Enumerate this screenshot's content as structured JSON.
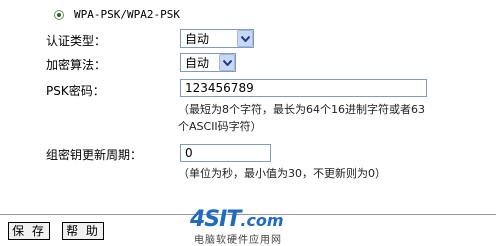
{
  "mode": {
    "selected_label": "WPA-PSK/WPA2-PSK"
  },
  "auth_type": {
    "label": "认证类型：",
    "value": "自动"
  },
  "encryption": {
    "label": "加密算法：",
    "value": "自动"
  },
  "psk": {
    "label": "PSK密码：",
    "value": "123456789",
    "hint_line1": "（最短为8个字符，最长为64个16进制字符或者63",
    "hint_line2": "个ASCII码字符）"
  },
  "group_key": {
    "label": "组密钥更新周期：",
    "value": "0",
    "hint": "（单位为秒，最小值为30，不更新则为0）"
  },
  "buttons": {
    "save": "保 存",
    "help": "帮 助"
  },
  "watermark": {
    "logo_main": "4SIT",
    "logo_suffix": ".com",
    "subtitle": "电脑软硬件应用网"
  }
}
